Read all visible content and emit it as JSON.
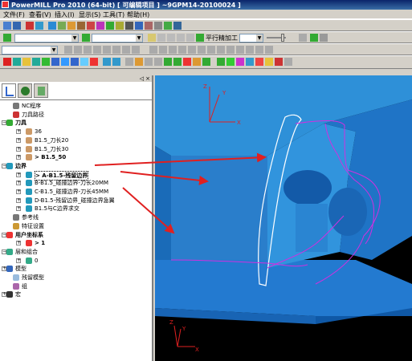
{
  "app": {
    "title": "PowerMILL Pro 2010 (64-bit)  [ 可编辑项目 ] ~9GPM14-20100024 ]"
  },
  "menu": [
    "文件(F)",
    "查看(V)",
    "插入(I)",
    "显示(S)",
    "工具(T)",
    "帮助(H)"
  ],
  "toolbar2": {
    "strategy_label": "平行精加工"
  },
  "tree": {
    "items": [
      {
        "label": "NC程序",
        "level": 1,
        "icon": "nc-program-icon"
      },
      {
        "label": "刀具路径",
        "level": 1,
        "icon": "toolpath-icon"
      },
      {
        "label": "刀具",
        "level": 0,
        "icon": "tool-icon",
        "bold": true
      },
      {
        "label": "36",
        "level": 2,
        "icon": "tool-item-icon"
      },
      {
        "label": "B1.5_刀长20",
        "level": 2,
        "icon": "tool-item-icon"
      },
      {
        "label": "B1.5_刀长30",
        "level": 2,
        "icon": "tool-item-icon"
      },
      {
        "label": "> B1.5_50",
        "level": 2,
        "icon": "tool-item-icon",
        "bold": true
      },
      {
        "label": "边界",
        "level": 0,
        "icon": "boundary-icon",
        "bold": true
      },
      {
        "label": "> A-B1.5-残留边界",
        "level": 2,
        "icon": "boundary-item-icon",
        "bold": true
      },
      {
        "label": "B-B1.5_碰撞边界-刀长20MM",
        "level": 2,
        "icon": "boundary-item-icon"
      },
      {
        "label": "C-B1.5_碰撞边界-刀长45MM",
        "level": 2,
        "icon": "boundary-item-icon"
      },
      {
        "label": "D-B1.5-残留边界_碰撞边界急翼",
        "level": 2,
        "icon": "boundary-item-icon"
      },
      {
        "label": "B1.5与C边界求交",
        "level": 2,
        "icon": "boundary-item-icon"
      },
      {
        "label": "参考线",
        "level": 1,
        "icon": "reference-line-icon"
      },
      {
        "label": "特征设置",
        "level": 1,
        "icon": "feature-icon"
      },
      {
        "label": "用户坐标系",
        "level": 0,
        "icon": "ucs-icon",
        "bold": true
      },
      {
        "label": "> 1",
        "level": 2,
        "icon": "ucs-item-icon",
        "bold": true
      },
      {
        "label": "层和组合",
        "level": 0,
        "icon": "layer-icon"
      },
      {
        "label": "0",
        "level": 2,
        "icon": "layer-item-icon"
      },
      {
        "label": "模型",
        "level": 0,
        "icon": "model-icon"
      },
      {
        "label": "残留模型",
        "level": 1,
        "icon": "stock-model-icon"
      },
      {
        "label": "组",
        "level": 1,
        "icon": "group-icon"
      },
      {
        "label": "宏",
        "level": 0,
        "icon": "macro-icon"
      }
    ]
  },
  "viewport": {
    "axis_top": {
      "x": "X",
      "y": "Y",
      "z": "Z"
    },
    "axis_bottom": {
      "x": "X",
      "y": "Y",
      "z": "Z"
    }
  }
}
